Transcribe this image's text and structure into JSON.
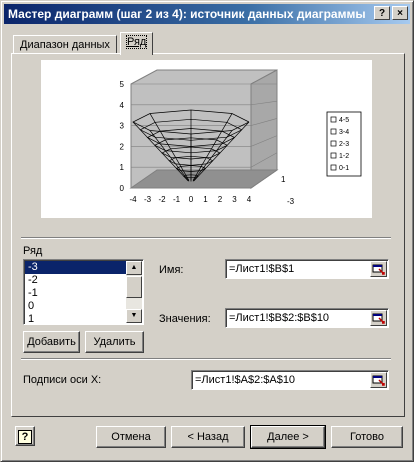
{
  "window": {
    "title": "Мастер диаграмм (шаг 2 из 4): источник данных диаграммы",
    "help_button": "?",
    "close_button": "×"
  },
  "tabs": [
    {
      "label": "Диапазон данных",
      "active": false
    },
    {
      "label": "Ряд",
      "active": true
    }
  ],
  "chart_preview": {
    "type": "surface-3d",
    "y_ticks": [
      "0",
      "1",
      "2",
      "3",
      "4",
      "5"
    ],
    "x_ticks": [
      "-4",
      "-3",
      "-2",
      "-1",
      "0",
      "1",
      "2",
      "3",
      "4"
    ],
    "depth_ticks": [
      "1",
      "-3"
    ],
    "legend": [
      "4-5",
      "3-4",
      "2-3",
      "1-2",
      "0-1"
    ]
  },
  "series": {
    "label": "Ряд",
    "items": [
      "-3",
      "-2",
      "-1",
      "0",
      "1"
    ],
    "selected_index": 0
  },
  "name_field": {
    "label": "Имя:",
    "value": "=Лист1!$B$1"
  },
  "values_field": {
    "label": "Значения:",
    "value": "=Лист1!$B$2:$B$10"
  },
  "buttons": {
    "add": "Добавить",
    "remove": "Удалить",
    "cancel": "Отмена",
    "back": "< Назад",
    "next": "Далее >",
    "finish": "Готово",
    "help": "?"
  },
  "x_labels": {
    "label": "Подписи оси X:",
    "value": "=Лист1!$A$2:$A$10"
  }
}
